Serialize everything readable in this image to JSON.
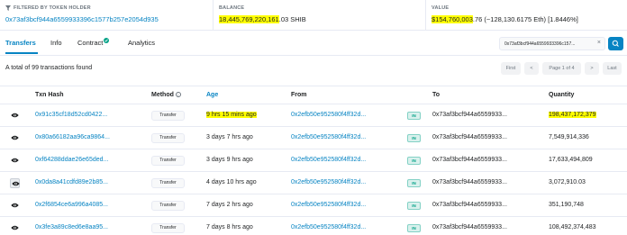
{
  "summary": {
    "holder": {
      "label": "FILTERED BY TOKEN HOLDER",
      "address": "0x73af3bcf944a6559933396c1577b257e2054d935"
    },
    "balance": {
      "label": "BALANCE",
      "main": "18,445,769,220,161",
      "rest": ".03 SHIB"
    },
    "value": {
      "label": "VALUE",
      "main": "$154,760,003",
      "rest": ".76 (~128,130.6175 Eth) [1.8446%]"
    }
  },
  "tabs": [
    {
      "label": "Transfers",
      "active": true
    },
    {
      "label": "Info",
      "active": false
    },
    {
      "label": "Contract",
      "active": false
    },
    {
      "label": "Analytics",
      "active": false
    }
  ],
  "search": {
    "value": "0x73af3bcf944a6559933396c157..."
  },
  "total_text": "A total of 99 transactions found",
  "pagination": {
    "first": "First",
    "prev": "<",
    "page_label": "Page 1 of 4",
    "next": ">",
    "last": "Last"
  },
  "table": {
    "headers": {
      "txn_hash": "Txn Hash",
      "method": "Method",
      "age": "Age",
      "from": "From",
      "to": "To",
      "quantity": "Quantity"
    },
    "direction_label": "IN",
    "rows": [
      {
        "hash": "0x91c35cf18d52cd0422...",
        "method": "Transfer",
        "age": "9 hrs 15 mins ago",
        "from": "0x2efb50e952580f4ff32d...",
        "to": "0x73af3bcf944a6559933...",
        "quantity": "198,437,172,379",
        "highlight": true
      },
      {
        "hash": "0x80a66182aa96ca9864...",
        "method": "Transfer",
        "age": "3 days 7 hrs ago",
        "from": "0x2efb50e952580f4ff32d...",
        "to": "0x73af3bcf944a6559933...",
        "quantity": "7,549,914,336",
        "highlight": false
      },
      {
        "hash": "0xf64288ddae26e65ded...",
        "method": "Transfer",
        "age": "3 days 9 hrs ago",
        "from": "0x2efb50e952580f4ff32d...",
        "to": "0x73af3bcf944a6559933...",
        "quantity": "17,633,494,809",
        "highlight": false
      },
      {
        "hash": "0x0da8a41cdfd89e2b85...",
        "method": "Transfer",
        "age": "4 days 10 hrs ago",
        "from": "0x2efb50e952580f4ff32d...",
        "to": "0x73af3bcf944a6559933...",
        "quantity": "3,072,910.03",
        "highlight": false
      },
      {
        "hash": "0x2f6854ce6a996a4085...",
        "method": "Transfer",
        "age": "7 days 2 hrs ago",
        "from": "0x2efb50e952580f4ff32d...",
        "to": "0x73af3bcf944a6559933...",
        "quantity": "351,190,748",
        "highlight": false
      },
      {
        "hash": "0x3fe3a89c8ed6e8aa95...",
        "method": "Transfer",
        "age": "7 days 8 hrs ago",
        "from": "0x2efb50e952580f4ff32d...",
        "to": "0x73af3bcf944a6559933...",
        "quantity": "108,492,374,483",
        "highlight": false
      }
    ]
  },
  "colors": {
    "link": "#0784c3",
    "highlight": "#ffff00",
    "in_badge": "#00a186"
  }
}
